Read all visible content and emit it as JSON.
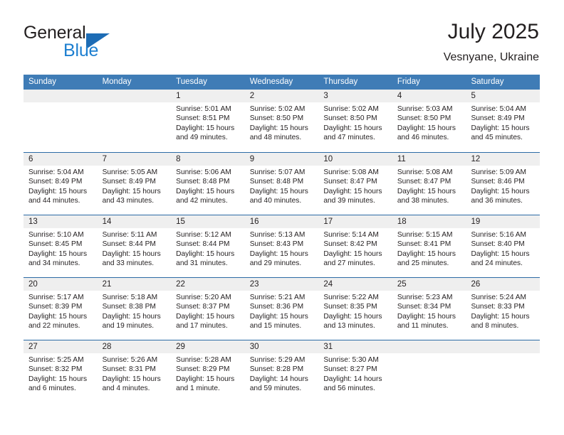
{
  "brand": {
    "word1": "General",
    "word2": "Blue",
    "triangle_color": "#1d6cb5",
    "blue_color": "#1d7fd0"
  },
  "header": {
    "title": "July 2025",
    "subtitle": "Vesnyane, Ukraine"
  },
  "colors": {
    "header_bar": "#3f7cb6",
    "week_divider": "#2c6ba5",
    "daterow_band": "#efefef",
    "text": "#231f20"
  },
  "weekdays": [
    "Sunday",
    "Monday",
    "Tuesday",
    "Wednesday",
    "Thursday",
    "Friday",
    "Saturday"
  ],
  "weeks": [
    [
      {
        "day": "",
        "empty": true
      },
      {
        "day": "",
        "empty": true
      },
      {
        "day": "1",
        "sunrise": "Sunrise: 5:01 AM",
        "sunset": "Sunset: 8:51 PM",
        "daylight1": "Daylight: 15 hours",
        "daylight2": "and 49 minutes."
      },
      {
        "day": "2",
        "sunrise": "Sunrise: 5:02 AM",
        "sunset": "Sunset: 8:50 PM",
        "daylight1": "Daylight: 15 hours",
        "daylight2": "and 48 minutes."
      },
      {
        "day": "3",
        "sunrise": "Sunrise: 5:02 AM",
        "sunset": "Sunset: 8:50 PM",
        "daylight1": "Daylight: 15 hours",
        "daylight2": "and 47 minutes."
      },
      {
        "day": "4",
        "sunrise": "Sunrise: 5:03 AM",
        "sunset": "Sunset: 8:50 PM",
        "daylight1": "Daylight: 15 hours",
        "daylight2": "and 46 minutes."
      },
      {
        "day": "5",
        "sunrise": "Sunrise: 5:04 AM",
        "sunset": "Sunset: 8:49 PM",
        "daylight1": "Daylight: 15 hours",
        "daylight2": "and 45 minutes."
      }
    ],
    [
      {
        "day": "6",
        "sunrise": "Sunrise: 5:04 AM",
        "sunset": "Sunset: 8:49 PM",
        "daylight1": "Daylight: 15 hours",
        "daylight2": "and 44 minutes."
      },
      {
        "day": "7",
        "sunrise": "Sunrise: 5:05 AM",
        "sunset": "Sunset: 8:49 PM",
        "daylight1": "Daylight: 15 hours",
        "daylight2": "and 43 minutes."
      },
      {
        "day": "8",
        "sunrise": "Sunrise: 5:06 AM",
        "sunset": "Sunset: 8:48 PM",
        "daylight1": "Daylight: 15 hours",
        "daylight2": "and 42 minutes."
      },
      {
        "day": "9",
        "sunrise": "Sunrise: 5:07 AM",
        "sunset": "Sunset: 8:48 PM",
        "daylight1": "Daylight: 15 hours",
        "daylight2": "and 40 minutes."
      },
      {
        "day": "10",
        "sunrise": "Sunrise: 5:08 AM",
        "sunset": "Sunset: 8:47 PM",
        "daylight1": "Daylight: 15 hours",
        "daylight2": "and 39 minutes."
      },
      {
        "day": "11",
        "sunrise": "Sunrise: 5:08 AM",
        "sunset": "Sunset: 8:47 PM",
        "daylight1": "Daylight: 15 hours",
        "daylight2": "and 38 minutes."
      },
      {
        "day": "12",
        "sunrise": "Sunrise: 5:09 AM",
        "sunset": "Sunset: 8:46 PM",
        "daylight1": "Daylight: 15 hours",
        "daylight2": "and 36 minutes."
      }
    ],
    [
      {
        "day": "13",
        "sunrise": "Sunrise: 5:10 AM",
        "sunset": "Sunset: 8:45 PM",
        "daylight1": "Daylight: 15 hours",
        "daylight2": "and 34 minutes."
      },
      {
        "day": "14",
        "sunrise": "Sunrise: 5:11 AM",
        "sunset": "Sunset: 8:44 PM",
        "daylight1": "Daylight: 15 hours",
        "daylight2": "and 33 minutes."
      },
      {
        "day": "15",
        "sunrise": "Sunrise: 5:12 AM",
        "sunset": "Sunset: 8:44 PM",
        "daylight1": "Daylight: 15 hours",
        "daylight2": "and 31 minutes."
      },
      {
        "day": "16",
        "sunrise": "Sunrise: 5:13 AM",
        "sunset": "Sunset: 8:43 PM",
        "daylight1": "Daylight: 15 hours",
        "daylight2": "and 29 minutes."
      },
      {
        "day": "17",
        "sunrise": "Sunrise: 5:14 AM",
        "sunset": "Sunset: 8:42 PM",
        "daylight1": "Daylight: 15 hours",
        "daylight2": "and 27 minutes."
      },
      {
        "day": "18",
        "sunrise": "Sunrise: 5:15 AM",
        "sunset": "Sunset: 8:41 PM",
        "daylight1": "Daylight: 15 hours",
        "daylight2": "and 25 minutes."
      },
      {
        "day": "19",
        "sunrise": "Sunrise: 5:16 AM",
        "sunset": "Sunset: 8:40 PM",
        "daylight1": "Daylight: 15 hours",
        "daylight2": "and 24 minutes."
      }
    ],
    [
      {
        "day": "20",
        "sunrise": "Sunrise: 5:17 AM",
        "sunset": "Sunset: 8:39 PM",
        "daylight1": "Daylight: 15 hours",
        "daylight2": "and 22 minutes."
      },
      {
        "day": "21",
        "sunrise": "Sunrise: 5:18 AM",
        "sunset": "Sunset: 8:38 PM",
        "daylight1": "Daylight: 15 hours",
        "daylight2": "and 19 minutes."
      },
      {
        "day": "22",
        "sunrise": "Sunrise: 5:20 AM",
        "sunset": "Sunset: 8:37 PM",
        "daylight1": "Daylight: 15 hours",
        "daylight2": "and 17 minutes."
      },
      {
        "day": "23",
        "sunrise": "Sunrise: 5:21 AM",
        "sunset": "Sunset: 8:36 PM",
        "daylight1": "Daylight: 15 hours",
        "daylight2": "and 15 minutes."
      },
      {
        "day": "24",
        "sunrise": "Sunrise: 5:22 AM",
        "sunset": "Sunset: 8:35 PM",
        "daylight1": "Daylight: 15 hours",
        "daylight2": "and 13 minutes."
      },
      {
        "day": "25",
        "sunrise": "Sunrise: 5:23 AM",
        "sunset": "Sunset: 8:34 PM",
        "daylight1": "Daylight: 15 hours",
        "daylight2": "and 11 minutes."
      },
      {
        "day": "26",
        "sunrise": "Sunrise: 5:24 AM",
        "sunset": "Sunset: 8:33 PM",
        "daylight1": "Daylight: 15 hours",
        "daylight2": "and 8 minutes."
      }
    ],
    [
      {
        "day": "27",
        "sunrise": "Sunrise: 5:25 AM",
        "sunset": "Sunset: 8:32 PM",
        "daylight1": "Daylight: 15 hours",
        "daylight2": "and 6 minutes."
      },
      {
        "day": "28",
        "sunrise": "Sunrise: 5:26 AM",
        "sunset": "Sunset: 8:31 PM",
        "daylight1": "Daylight: 15 hours",
        "daylight2": "and 4 minutes."
      },
      {
        "day": "29",
        "sunrise": "Sunrise: 5:28 AM",
        "sunset": "Sunset: 8:29 PM",
        "daylight1": "Daylight: 15 hours",
        "daylight2": "and 1 minute."
      },
      {
        "day": "30",
        "sunrise": "Sunrise: 5:29 AM",
        "sunset": "Sunset: 8:28 PM",
        "daylight1": "Daylight: 14 hours",
        "daylight2": "and 59 minutes."
      },
      {
        "day": "31",
        "sunrise": "Sunrise: 5:30 AM",
        "sunset": "Sunset: 8:27 PM",
        "daylight1": "Daylight: 14 hours",
        "daylight2": "and 56 minutes."
      },
      {
        "day": "",
        "empty": true
      },
      {
        "day": "",
        "empty": true
      }
    ]
  ]
}
